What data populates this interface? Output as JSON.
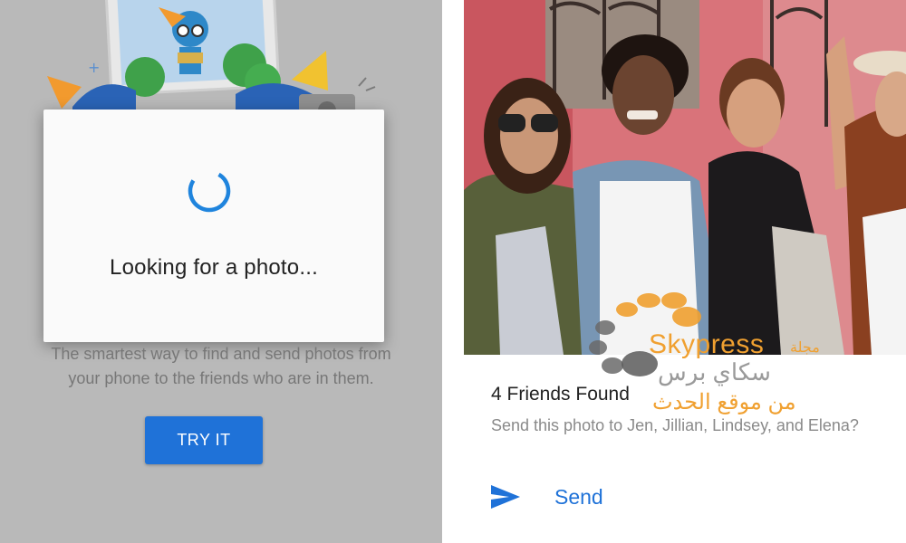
{
  "left_panel": {
    "dialog": {
      "message": "Looking for a photo..."
    },
    "tagline_line1": "The smartest way to find and send photos from",
    "tagline_line2": "your phone to the friends who are in them.",
    "try_button_label": "TRY IT"
  },
  "right_panel": {
    "friends_found_title": "4 Friends Found",
    "friends_found_subtitle": "Send this photo to Jen, Jillian, Lindsey, and Elena?",
    "send_label": "Send"
  },
  "watermark": {
    "brand": "Skypress",
    "arabic_small": "مجلة",
    "arabic_name": "سكاي برس",
    "arabic_slogan": "من موقع الحدث"
  },
  "colors": {
    "accent_blue": "#1f72d8",
    "left_background": "#b9b9b9",
    "watermark_orange": "#f0a030"
  },
  "icons": [
    "spinner-icon",
    "send-arrow-icon",
    "camera-icon",
    "plus-icon"
  ]
}
